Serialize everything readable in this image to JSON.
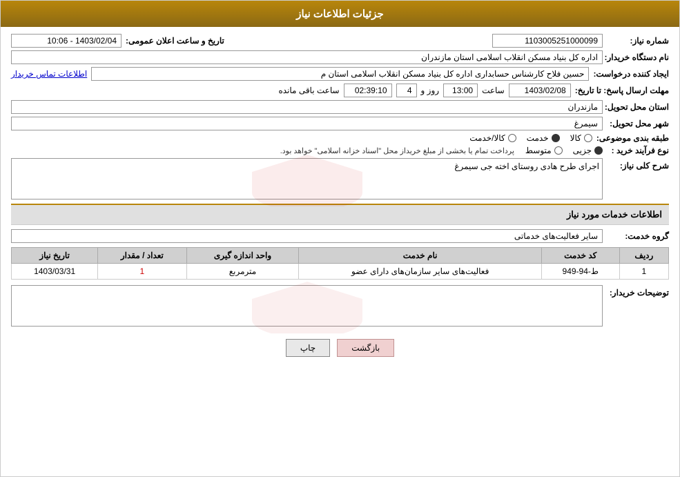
{
  "header": {
    "title": "جزئیات اطلاعات نیاز"
  },
  "fields": {
    "need_number_label": "شماره نیاز:",
    "need_number_value": "1103005251000099",
    "announcement_label": "تاریخ و ساعت اعلان عمومی:",
    "announcement_value": "1403/02/04 - 10:06",
    "buyer_org_label": "نام دستگاه خریدار:",
    "buyer_org_value": "اداره کل بنیاد مسکن انقلاب اسلامی استان مازندران",
    "requester_label": "ایجاد کننده درخواست:",
    "requester_value": "حسین فلاح کارشناس حسابداری اداره کل بنیاد مسکن انقلاب اسلامی استان م",
    "contact_link": "اطلاعات تماس خریدار",
    "response_deadline_label": "مهلت ارسال پاسخ: تا تاریخ:",
    "deadline_date": "1403/02/08",
    "deadline_time_label": "ساعت",
    "deadline_time": "13:00",
    "deadline_days_label": "روز و",
    "deadline_days": "4",
    "remaining_label": "ساعت باقی مانده",
    "remaining_time": "02:39:10",
    "delivery_province_label": "استان محل تحویل:",
    "delivery_province_value": "مازندران",
    "delivery_city_label": "شهر محل تحویل:",
    "delivery_city_value": "سیمرغ",
    "category_label": "طبقه بندی موضوعی:",
    "category_kala": "کالا",
    "category_khadamat": "خدمت",
    "category_kala_khadamat": "کالا/خدمت",
    "category_selected": "khadamat",
    "purchase_type_label": "نوع فرآیند خرید :",
    "purchase_jozii": "جزیی",
    "purchase_motavasset": "متوسط",
    "purchase_selected": "jozii",
    "purchase_notice": "پرداخت تمام یا بخشی از مبلغ خریداز محل \"اسناد خزانه اسلامی\" خواهد بود.",
    "need_description_label": "شرح کلی نیاز:",
    "need_description_value": "اجرای طرح هادی روستای اخته جی سیمرغ",
    "services_section_label": "اطلاعات خدمات مورد نیاز",
    "service_group_label": "گروه خدمت:",
    "service_group_value": "سایر فعالیت‌های خدماتی",
    "table": {
      "col_radif": "ردیف",
      "col_code": "کد خدمت",
      "col_name": "نام خدمت",
      "col_unit": "واحد اندازه گیری",
      "col_count": "تعداد / مقدار",
      "col_date": "تاریخ نیاز",
      "rows": [
        {
          "radif": "1",
          "code": "ط-94-949",
          "name": "فعالیت‌های سایر سازمان‌های دارای عضو",
          "unit": "مترمربع",
          "count": "1",
          "date": "1403/03/31"
        }
      ]
    },
    "buyer_notes_label": "توضیحات خریدار:",
    "buyer_notes_value": ""
  },
  "buttons": {
    "print_label": "چاپ",
    "back_label": "بازگشت"
  }
}
